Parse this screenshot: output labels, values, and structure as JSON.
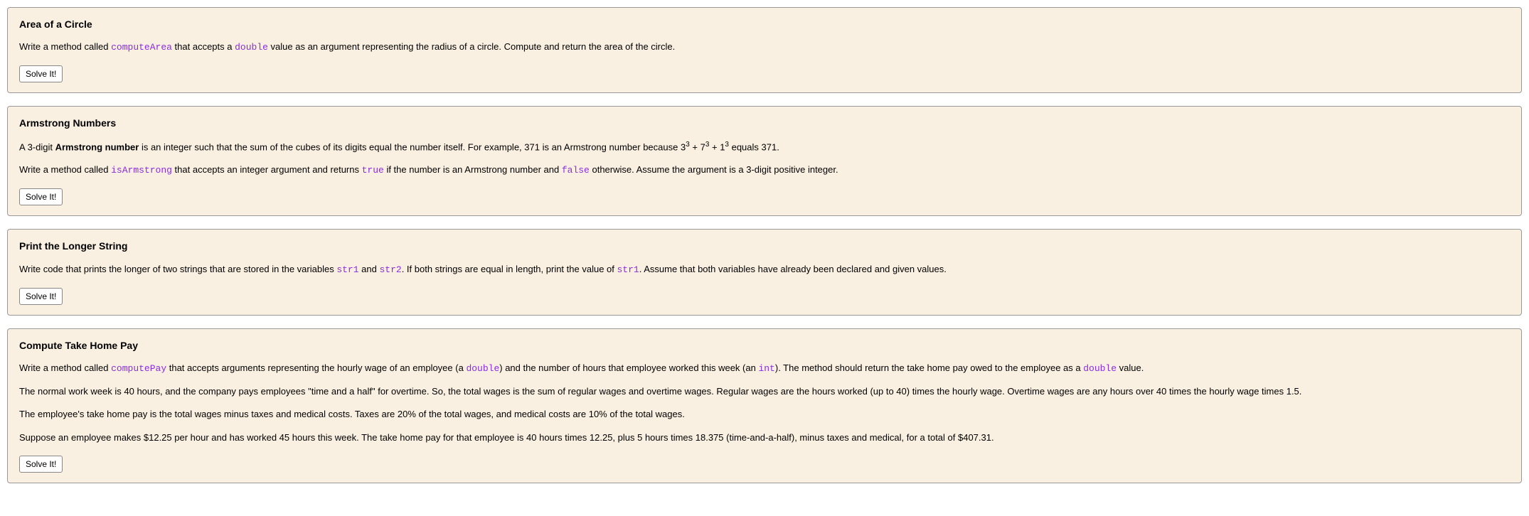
{
  "solve_button_label": "Solve It!",
  "problems": [
    {
      "title": "Area of a Circle",
      "desc_pre": "Write a method called ",
      "code1": "computeArea",
      "desc_mid1": " that accepts a ",
      "code2": "double",
      "desc_post": " value as an argument representing the radius of a circle. Compute and return the area of the circle."
    },
    {
      "title": "Armstrong Numbers",
      "p1_pre": "A 3-digit ",
      "p1_bold": "Armstrong number",
      "p1_post": " is an integer such that the sum of the cubes of its digits equal the number itself. For example, 371 is an Armstrong number because 3",
      "sup1": "3",
      "p1_mid1": " + 7",
      "sup2": "3",
      "p1_mid2": " + 1",
      "sup3": "3",
      "p1_end": " equals 371.",
      "p2_pre": "Write a method called ",
      "code1": "isArmstrong",
      "p2_mid1": " that accepts an integer argument and returns ",
      "code2": "true",
      "p2_mid2": " if the number is an Armstrong number and ",
      "code3": "false",
      "p2_post": " otherwise. Assume the argument is a 3-digit positive integer."
    },
    {
      "title": "Print the Longer String",
      "p1_pre": "Write code that prints the longer of two strings that are stored in the variables ",
      "code1": "str1",
      "p1_mid1": " and ",
      "code2": "str2",
      "p1_mid2": ". If both strings are equal in length, print the value of ",
      "code3": "str1",
      "p1_post": ". Assume that both variables have already been declared and given values."
    },
    {
      "title": "Compute Take Home Pay",
      "p1_pre": "Write a method called ",
      "code1": "computePay",
      "p1_mid1": " that accepts arguments representing the hourly wage of an employee (a ",
      "code2": "double",
      "p1_mid2": ") and the number of hours that employee worked this week (an ",
      "code3": "int",
      "p1_mid3": "). The method should return the take home pay owed to the employee as a ",
      "code4": "double",
      "p1_post": " value.",
      "p2": "The normal work week is 40 hours, and the company pays employees \"time and a half\" for overtime. So, the total wages is the sum of regular wages and overtime wages. Regular wages are the hours worked (up to 40) times the hourly wage. Overtime wages are any hours over 40 times the hourly wage times 1.5.",
      "p3": "The employee's take home pay is the total wages minus taxes and medical costs. Taxes are 20% of the total wages, and medical costs are 10% of the total wages.",
      "p4": "Suppose an employee makes $12.25 per hour and has worked 45 hours this week. The take home pay for that employee is 40 hours times 12.25, plus 5 hours times 18.375 (time-and-a-half), minus taxes and medical, for a total of $407.31."
    }
  ]
}
